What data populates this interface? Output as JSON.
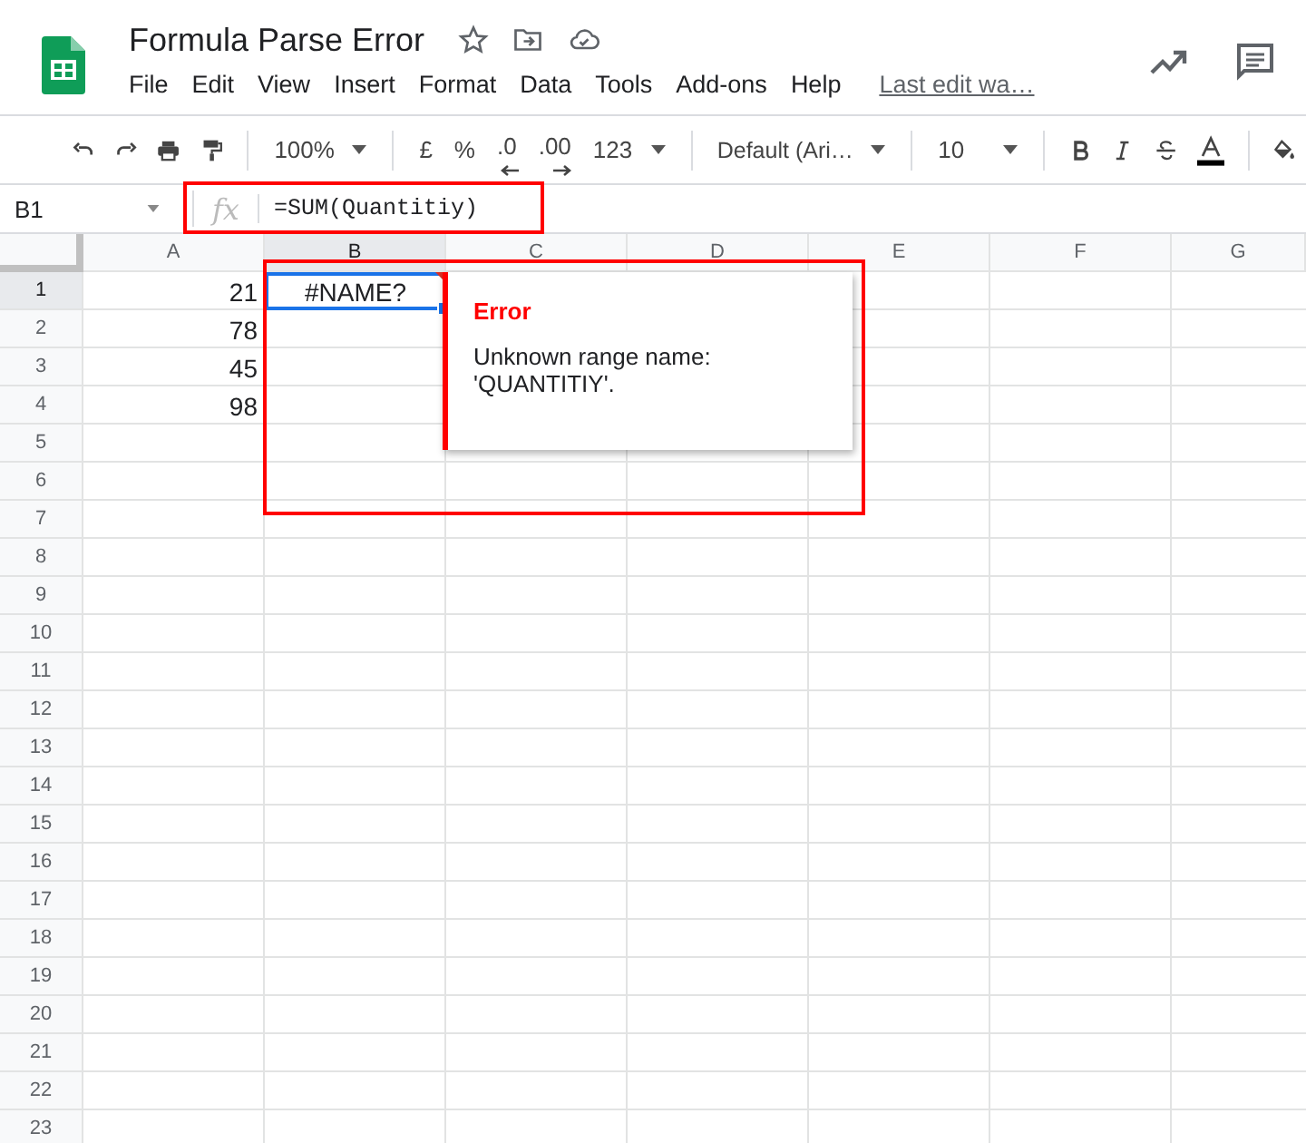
{
  "document": {
    "title": "Formula Parse Error",
    "last_edit": "Last edit wa…"
  },
  "menu": [
    "File",
    "Edit",
    "View",
    "Insert",
    "Format",
    "Data",
    "Tools",
    "Add-ons",
    "Help"
  ],
  "toolbar": {
    "zoom": "100%",
    "currency": "£",
    "percent": "%",
    "decimal_decrease": ".0",
    "decimal_increase": ".00",
    "more_formats": "123",
    "font": "Default (Ari…",
    "font_size": "10"
  },
  "formula_bar": {
    "cell_ref": "B1",
    "fx": "fx",
    "formula": "=SUM(Quantitiy)"
  },
  "columns": [
    {
      "label": "A",
      "selected": false
    },
    {
      "label": "B",
      "selected": true
    },
    {
      "label": "C",
      "selected": false
    },
    {
      "label": "D",
      "selected": false
    },
    {
      "label": "E",
      "selected": false
    },
    {
      "label": "F",
      "selected": false
    },
    {
      "label": "G",
      "selected": false
    }
  ],
  "rows": [
    {
      "label": "1",
      "selected": true,
      "cells": [
        {
          "text": "21",
          "kind": "number",
          "selected": false
        },
        {
          "text": "#NAME?",
          "kind": "error",
          "selected": true
        }
      ]
    },
    {
      "label": "2",
      "selected": false,
      "cells": [
        {
          "text": "78",
          "kind": "number",
          "selected": false
        }
      ]
    },
    {
      "label": "3",
      "selected": false,
      "cells": [
        {
          "text": "45",
          "kind": "number",
          "selected": false
        }
      ]
    },
    {
      "label": "4",
      "selected": false,
      "cells": [
        {
          "text": "98",
          "kind": "number",
          "selected": false
        }
      ]
    },
    {
      "label": "5",
      "selected": false
    },
    {
      "label": "6",
      "selected": false
    },
    {
      "label": "7",
      "selected": false
    },
    {
      "label": "8",
      "selected": false
    },
    {
      "label": "9",
      "selected": false
    },
    {
      "label": "10",
      "selected": false
    },
    {
      "label": "11",
      "selected": false
    },
    {
      "label": "12",
      "selected": false
    },
    {
      "label": "13",
      "selected": false
    },
    {
      "label": "14",
      "selected": false
    },
    {
      "label": "15",
      "selected": false
    },
    {
      "label": "16",
      "selected": false
    },
    {
      "label": "17",
      "selected": false
    },
    {
      "label": "18",
      "selected": false
    },
    {
      "label": "19",
      "selected": false
    },
    {
      "label": "20",
      "selected": false
    },
    {
      "label": "21",
      "selected": false
    },
    {
      "label": "22",
      "selected": false
    },
    {
      "label": "23",
      "selected": false
    }
  ],
  "error_popup": {
    "title": "Error",
    "message": "Unknown range name: 'QUANTITIY'."
  }
}
